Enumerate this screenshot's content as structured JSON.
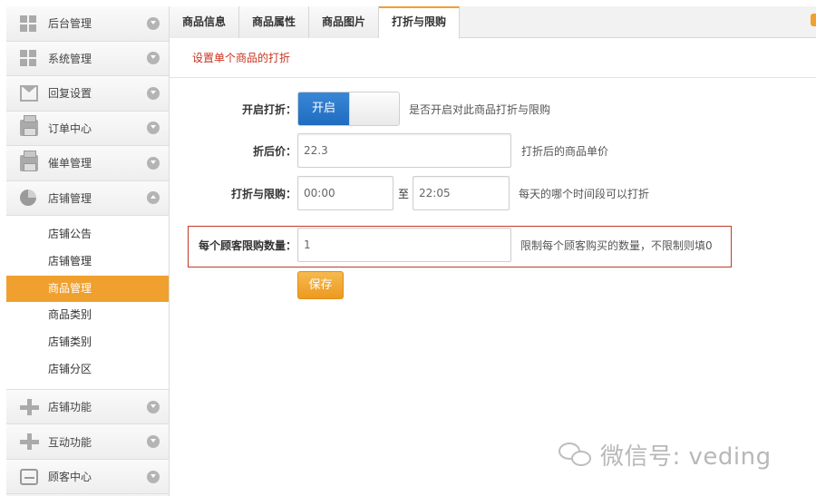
{
  "sidebar": {
    "items_top": [
      {
        "label": "后台管理",
        "icon": "grid-icon"
      },
      {
        "label": "系统管理",
        "icon": "grid-icon"
      },
      {
        "label": "回复设置",
        "icon": "mail-icon"
      },
      {
        "label": "订单中心",
        "icon": "printer-icon"
      },
      {
        "label": "催单管理",
        "icon": "printer-icon"
      },
      {
        "label": "店铺管理",
        "icon": "pie-chart-icon"
      }
    ],
    "sub_items": [
      {
        "label": "店铺公告"
      },
      {
        "label": "店铺管理"
      },
      {
        "label": "商品管理"
      },
      {
        "label": "商品类别"
      },
      {
        "label": "店铺类别"
      },
      {
        "label": "店铺分区"
      }
    ],
    "items_bottom": [
      {
        "label": "店铺功能",
        "icon": "plus-icon"
      },
      {
        "label": "互动功能",
        "icon": "plus-icon"
      },
      {
        "label": "顾客中心",
        "icon": "tray-icon"
      }
    ],
    "active_sub": "商品管理",
    "accent_color": "#f0a02e"
  },
  "tabs": [
    {
      "label": "商品信息"
    },
    {
      "label": "商品属性"
    },
    {
      "label": "商品图片"
    },
    {
      "label": "打折与限购"
    }
  ],
  "active_tab": "打折与限购",
  "section_title": "设置单个商品的打折",
  "form": {
    "enable": {
      "label": "开启打折：",
      "toggle_on_text": "开启",
      "hint": "是否开启对此商品打折与限购"
    },
    "price": {
      "label": "折后价：",
      "value": "22.3",
      "hint": "打折后的商品单价"
    },
    "time": {
      "label": "打折与限购：",
      "start": "00:00",
      "separator": "至",
      "end": "22:05",
      "hint": "每天的哪个时间段可以打折"
    },
    "limit": {
      "label": "每个顾客限购数量：",
      "value": "1",
      "hint": "限制每个顾客购买的数量，不限制则填0"
    },
    "save_label": "保存"
  },
  "watermark": {
    "text": "微信号: veding"
  }
}
